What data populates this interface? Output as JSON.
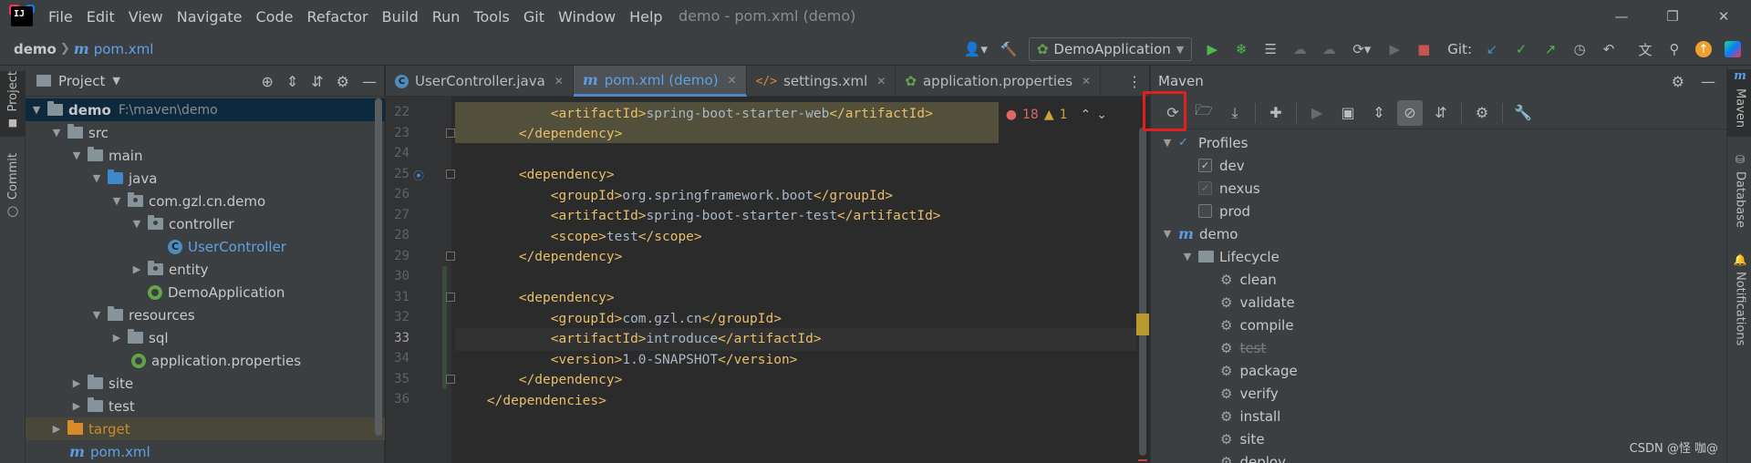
{
  "menubar": {
    "items": [
      "File",
      "Edit",
      "View",
      "Navigate",
      "Code",
      "Refactor",
      "Build",
      "Run",
      "Tools",
      "Git",
      "Window",
      "Help"
    ],
    "title": "demo - pom.xml (demo)"
  },
  "navbar": {
    "project": "demo",
    "file": "pom.xml",
    "run_config": "DemoApplication",
    "git_label": "Git:"
  },
  "left_stripe": {
    "project_tab": "Project",
    "commit_tab": "Commit"
  },
  "project_panel": {
    "title": "Project",
    "tree": [
      {
        "label": "demo",
        "path": "F:\\maven\\demo",
        "level": 0,
        "expanded": true,
        "kind": "module",
        "selected": true
      },
      {
        "label": "src",
        "level": 1,
        "expanded": true,
        "kind": "folder"
      },
      {
        "label": "main",
        "level": 2,
        "expanded": true,
        "kind": "folder"
      },
      {
        "label": "java",
        "level": 3,
        "expanded": true,
        "kind": "source-folder"
      },
      {
        "label": "com.gzl.cn.demo",
        "level": 4,
        "expanded": true,
        "kind": "package"
      },
      {
        "label": "controller",
        "level": 5,
        "expanded": true,
        "kind": "package"
      },
      {
        "label": "UserController",
        "level": 6,
        "kind": "class"
      },
      {
        "label": "entity",
        "level": 5,
        "expanded": false,
        "kind": "package"
      },
      {
        "label": "DemoApplication",
        "level": 5,
        "kind": "spring-class"
      },
      {
        "label": "resources",
        "level": 3,
        "expanded": true,
        "kind": "resources"
      },
      {
        "label": "sql",
        "level": 4,
        "expanded": false,
        "kind": "folder"
      },
      {
        "label": "application.properties",
        "level": 4,
        "kind": "properties"
      },
      {
        "label": "site",
        "level": 2,
        "expanded": false,
        "kind": "folder"
      },
      {
        "label": "test",
        "level": 2,
        "expanded": false,
        "kind": "folder"
      },
      {
        "label": "target",
        "level": 1,
        "expanded": false,
        "kind": "excluded"
      },
      {
        "label": "pom.xml",
        "level": 1,
        "kind": "maven"
      }
    ]
  },
  "editor": {
    "tabs": [
      {
        "label": "UserController.java",
        "icon": "class-icon",
        "active": false
      },
      {
        "label": "pom.xml (demo)",
        "icon": "maven-icon",
        "active": true
      },
      {
        "label": "settings.xml",
        "icon": "xml-icon",
        "active": false
      },
      {
        "label": "application.properties",
        "icon": "spring-icon",
        "active": false
      }
    ],
    "inspection": {
      "errors": "18",
      "warnings": "1"
    },
    "current_line": 33,
    "lines": [
      {
        "no": "22",
        "text": "            <artifactId>spring-boot-starter-web</artifactId>"
      },
      {
        "no": "23",
        "text": "        </dependency>"
      },
      {
        "no": "24",
        "text": ""
      },
      {
        "no": "25",
        "text": "        <dependency>"
      },
      {
        "no": "26",
        "text": "            <groupId>org.springframework.boot</groupId>"
      },
      {
        "no": "27",
        "text": "            <artifactId>spring-boot-starter-test</artifactId>"
      },
      {
        "no": "28",
        "text": "            <scope>test</scope>"
      },
      {
        "no": "29",
        "text": "        </dependency>"
      },
      {
        "no": "30",
        "text": ""
      },
      {
        "no": "31",
        "text": "        <dependency>"
      },
      {
        "no": "32",
        "text": "            <groupId>com.gzl.cn</groupId>"
      },
      {
        "no": "33",
        "text": "            <artifactId>introduce</artifactId>"
      },
      {
        "no": "34",
        "text": "            <version>1.0-SNAPSHOT</version>"
      },
      {
        "no": "35",
        "text": "        </dependency>"
      },
      {
        "no": "36",
        "text": "    </dependencies>"
      }
    ]
  },
  "maven_panel": {
    "title": "Maven",
    "tree": [
      {
        "label": "Profiles",
        "level": 0,
        "expanded": true,
        "kind": "profiles"
      },
      {
        "label": "dev",
        "level": 1,
        "kind": "profile",
        "checked": true
      },
      {
        "label": "nexus",
        "level": 1,
        "kind": "profile",
        "checked": true,
        "disabled": true
      },
      {
        "label": "prod",
        "level": 1,
        "kind": "profile",
        "checked": false
      },
      {
        "label": "demo",
        "level": 0,
        "expanded": true,
        "kind": "project"
      },
      {
        "label": "Lifecycle",
        "level": 1,
        "expanded": true,
        "kind": "lifecycle"
      },
      {
        "label": "clean",
        "level": 2,
        "kind": "goal"
      },
      {
        "label": "validate",
        "level": 2,
        "kind": "goal"
      },
      {
        "label": "compile",
        "level": 2,
        "kind": "goal"
      },
      {
        "label": "test",
        "level": 2,
        "kind": "goal",
        "skipped": true
      },
      {
        "label": "package",
        "level": 2,
        "kind": "goal"
      },
      {
        "label": "verify",
        "level": 2,
        "kind": "goal"
      },
      {
        "label": "install",
        "level": 2,
        "kind": "goal"
      },
      {
        "label": "site",
        "level": 2,
        "kind": "goal"
      },
      {
        "label": "deploy",
        "level": 2,
        "kind": "goal"
      }
    ]
  },
  "right_stripe": {
    "maven_tab": "Maven",
    "database_tab": "Database",
    "notifications_tab": "Notifications"
  },
  "watermark": "CSDN @怪 咖@",
  "colors": {
    "accent": "#4a88c7",
    "highlight_box": "#e02020",
    "xml_tag": "#e8bf6a",
    "text": "#a9b7c6"
  }
}
